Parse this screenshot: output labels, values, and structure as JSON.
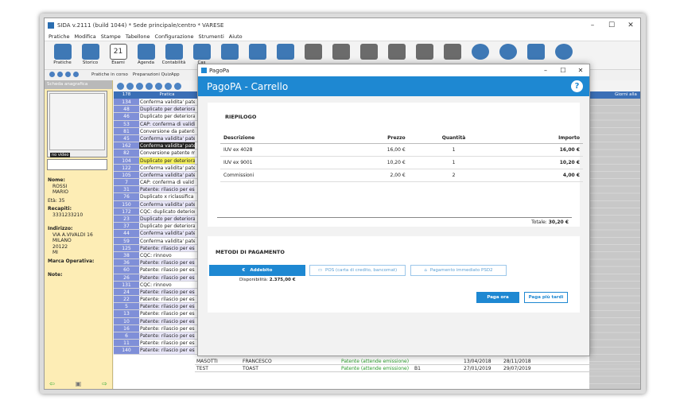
{
  "app": {
    "title": "SIDA v.2111 (build 1044) * Sede principale/centro * VARESE",
    "menu": [
      "Pratiche",
      "Modifica",
      "Stampe",
      "Tabellone",
      "Configurazione",
      "Strumenti",
      "Aiuto"
    ],
    "toolbar": [
      "Pratiche",
      "Storico",
      "Esami",
      "Agenda",
      "Contabilità",
      "Cas",
      "",
      "",
      "",
      "",
      "",
      "",
      "",
      "",
      "",
      "",
      "",
      "",
      "",
      "",
      ""
    ],
    "toolbar_sub": {
      "esami_num": "21",
      "tab1": "Pratiche in corso",
      "tab2": "Preparazioni QuizApp"
    }
  },
  "left_panel": {
    "header": "Scheda anagrafica",
    "no_video": "no video",
    "name_label": "Nome:",
    "name_surname": "ROSSI",
    "name_first": "MARIO",
    "age": "Età: 35",
    "phone_label": "Recapiti:",
    "phone": "3331233210",
    "address_label": "Indirizzo:",
    "address": [
      "VIA A.VIVALDI 16",
      "MILANO",
      "20122",
      "MI"
    ],
    "brand_label": "Marca Operativa:",
    "notes_label": "Note:"
  },
  "grid": {
    "header_num": "178",
    "header_pratica": "Pratica",
    "header_last": "Giorni alla",
    "rows": [
      {
        "n": "134",
        "t": "Conferma validita' patente",
        "s": ""
      },
      {
        "n": "48",
        "t": "Duplicato per deteriora",
        "s": "alt"
      },
      {
        "n": "46",
        "t": "Duplicato per deteriora",
        "s": ""
      },
      {
        "n": "53",
        "t": "CAP: conferma di validi",
        "s": "alt"
      },
      {
        "n": "81",
        "t": "Conversione da patente",
        "s": ""
      },
      {
        "n": "45",
        "t": "Conferma validita' pate",
        "s": "alt"
      },
      {
        "n": "162",
        "t": "Conferma validita' pate",
        "s": "sel"
      },
      {
        "n": "82",
        "t": "Conversione patente m",
        "s": ""
      },
      {
        "n": "104",
        "t": "Duplicato per deteriora",
        "s": "yel"
      },
      {
        "n": "122",
        "t": "Conferma validita' pate",
        "s": ""
      },
      {
        "n": "105",
        "t": "Conferma validita' pate",
        "s": "alt"
      },
      {
        "n": "7",
        "t": "CAP: conferma di valid",
        "s": ""
      },
      {
        "n": "31",
        "t": "Patente: rilascio per es",
        "s": "alt"
      },
      {
        "n": "76",
        "t": "Duplicato x riclassifica",
        "s": ""
      },
      {
        "n": "150",
        "t": "Conferma validita' pate",
        "s": "alt"
      },
      {
        "n": "172",
        "t": "CQC: duplicato deterior",
        "s": ""
      },
      {
        "n": "23",
        "t": "Duplicato per deteriora",
        "s": "alt"
      },
      {
        "n": "37",
        "t": "Duplicato per deteriora",
        "s": ""
      },
      {
        "n": "44",
        "t": "Conferma validita' pate",
        "s": "alt"
      },
      {
        "n": "59",
        "t": "Conferma validita' pate",
        "s": ""
      },
      {
        "n": "125",
        "t": "Patente: rilascio per es",
        "s": "alt"
      },
      {
        "n": "38",
        "t": "CQC: rinnovo",
        "s": ""
      },
      {
        "n": "36",
        "t": "Patente: rilascio per es",
        "s": "alt"
      },
      {
        "n": "60",
        "t": "Patente: rilascio per es",
        "s": ""
      },
      {
        "n": "26",
        "t": "Patente: rilascio per es",
        "s": "alt"
      },
      {
        "n": "131",
        "t": "CQC: rinnovo",
        "s": ""
      },
      {
        "n": "24",
        "t": "Patente: rilascio per es",
        "s": "alt"
      },
      {
        "n": "22",
        "t": "Patente: rilascio per es",
        "s": ""
      },
      {
        "n": "5",
        "t": "Patente: rilascio per es",
        "s": "alt"
      },
      {
        "n": "13",
        "t": "Patente: rilascio per es",
        "s": ""
      },
      {
        "n": "10",
        "t": "Patente: rilascio per es",
        "s": "alt"
      },
      {
        "n": "16",
        "t": "Patente: rilascio per es",
        "s": ""
      },
      {
        "n": "6",
        "t": "Patente: rilascio per es",
        "s": "alt"
      },
      {
        "n": "11",
        "t": "Patente: rilascio per es",
        "s": ""
      },
      {
        "n": "140",
        "t": "Patente: rilascio per esame",
        "s": "alt"
      }
    ],
    "bottom_rows": [
      {
        "a": "MASOTTI",
        "b": "FRANCESCO",
        "c": "Patente (attende emissione)",
        "d": "",
        "e": "13/04/2018",
        "f": "28/11/2018"
      },
      {
        "a": "TEST",
        "b": "TOAST",
        "c": "Patente (attende emissione)",
        "d": "B1",
        "e": "27/01/2019",
        "f": "29/07/2019"
      }
    ]
  },
  "modal": {
    "window_title": "PagoPa",
    "header": "PagoPA - Carrello",
    "summary_title": "RIEPILOGO",
    "columns": [
      "Descrizione",
      "Prezzo",
      "Quantità",
      "Importo"
    ],
    "items": [
      {
        "desc": "IUV ex 4028",
        "price": "16,00 €",
        "qty": "1",
        "amount": "16,00 €"
      },
      {
        "desc": "IUV ex 9001",
        "price": "10,20 €",
        "qty": "1",
        "amount": "10,20 €"
      },
      {
        "desc": "Commissioni",
        "price": "2,00 €",
        "qty": "2",
        "amount": "4,00 €"
      }
    ],
    "total_label": "Totale:",
    "total_value": "30,20 €",
    "methods_title": "METODI DI PAGAMENTO",
    "method_addebito": "Addebito",
    "method_pos": "POS (carta di credito, bancomat)",
    "method_psd2": "Pagamento immediato PSD2",
    "availability_label": "Disponibilità:",
    "availability_value": "2.375,00 €",
    "pay_now": "Paga ora",
    "pay_later": "Paga più tardi"
  },
  "colors": {
    "accent": "#1e88d2",
    "grid_header": "#3b6fb6",
    "left_bg": "#fdedb5"
  }
}
